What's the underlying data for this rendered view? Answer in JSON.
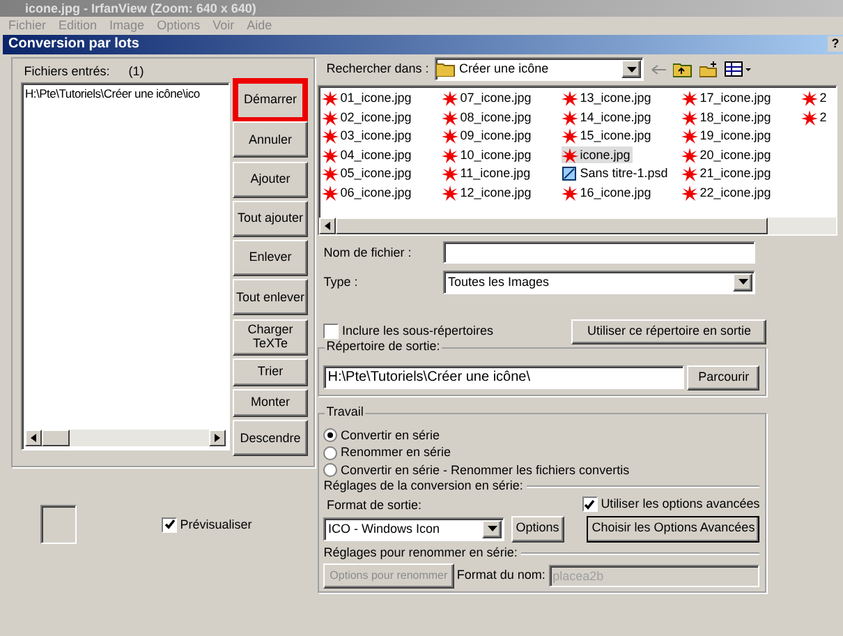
{
  "app_window": {
    "title": "icone.jpg - IrfanView (Zoom: 640 x 640)",
    "menu": [
      "Fichier",
      "Edition",
      "Image",
      "Options",
      "Voir",
      "Aide"
    ]
  },
  "dialog": {
    "title": "Conversion par lots",
    "help": "?"
  },
  "input_files": {
    "label": "Fichiers entrés:",
    "count": "(1)",
    "items": [
      "H:\\Pte\\Tutoriels\\Créer une icône\\ico"
    ]
  },
  "action_buttons": [
    {
      "label": "Démarrer",
      "highlighted": true
    },
    {
      "label": "Annuler",
      "highlighted": false
    },
    {
      "label": "Ajouter",
      "highlighted": false
    },
    {
      "label": "Tout ajouter",
      "highlighted": false
    },
    {
      "label": "Enlever",
      "highlighted": false
    },
    {
      "label": "Tout enlever",
      "highlighted": false
    },
    {
      "label": "Charger TeXTe",
      "highlighted": false
    },
    {
      "label": "Trier",
      "highlighted": false
    },
    {
      "label": "Monter",
      "highlighted": false
    },
    {
      "label": "Descendre",
      "highlighted": false
    }
  ],
  "preview": {
    "label": "Prévisualiser",
    "checked": true
  },
  "browser": {
    "look_in_label": "Rechercher dans :",
    "folder": "Créer une icône",
    "files": [
      {
        "name": "01_icone.jpg",
        "kind": "jpg",
        "selected": false
      },
      {
        "name": "02_icone.jpg",
        "kind": "jpg",
        "selected": false
      },
      {
        "name": "03_icone.jpg",
        "kind": "jpg",
        "selected": false
      },
      {
        "name": "04_icone.jpg",
        "kind": "jpg",
        "selected": false
      },
      {
        "name": "05_icone.jpg",
        "kind": "jpg",
        "selected": false
      },
      {
        "name": "06_icone.jpg",
        "kind": "jpg",
        "selected": false
      },
      {
        "name": "07_icone.jpg",
        "kind": "jpg",
        "selected": false
      },
      {
        "name": "08_icone.jpg",
        "kind": "jpg",
        "selected": false
      },
      {
        "name": "09_icone.jpg",
        "kind": "jpg",
        "selected": false
      },
      {
        "name": "10_icone.jpg",
        "kind": "jpg",
        "selected": false
      },
      {
        "name": "11_icone.jpg",
        "kind": "jpg",
        "selected": false
      },
      {
        "name": "12_icone.jpg",
        "kind": "jpg",
        "selected": false
      },
      {
        "name": "13_icone.jpg",
        "kind": "jpg",
        "selected": false
      },
      {
        "name": "14_icone.jpg",
        "kind": "jpg",
        "selected": false
      },
      {
        "name": "15_icone.jpg",
        "kind": "jpg",
        "selected": false
      },
      {
        "name": "icone.jpg",
        "kind": "jpg",
        "selected": true
      },
      {
        "name": "Sans titre-1.psd",
        "kind": "psd",
        "selected": false
      },
      {
        "name": "16_icone.jpg",
        "kind": "jpg",
        "selected": false
      },
      {
        "name": "17_icone.jpg",
        "kind": "jpg",
        "selected": false
      },
      {
        "name": "18_icone.jpg",
        "kind": "jpg",
        "selected": false
      },
      {
        "name": "19_icone.jpg",
        "kind": "jpg",
        "selected": false
      },
      {
        "name": "20_icone.jpg",
        "kind": "jpg",
        "selected": false
      },
      {
        "name": "21_icone.jpg",
        "kind": "jpg",
        "selected": false
      },
      {
        "name": "22_icone.jpg",
        "kind": "jpg",
        "selected": false
      },
      {
        "name": "2",
        "kind": "jpg",
        "selected": false
      },
      {
        "name": "2",
        "kind": "jpg",
        "selected": false
      }
    ],
    "filename_label": "Nom de fichier :",
    "type_label": "Type :",
    "type_value": "Toutes les Images"
  },
  "include_subfolders": {
    "label": "Inclure les sous-répertoires",
    "checked": false
  },
  "use_folder_button": "Utiliser ce répertoire en sortie",
  "output_dir": {
    "label": "Répertoire de sortie:",
    "value": "H:\\Pte\\Tutoriels\\Créer une icône\\",
    "browse_button": "Parcourir"
  },
  "work": {
    "label": "Travail",
    "options": [
      {
        "label": "Convertir en série",
        "selected": true
      },
      {
        "label": "Renommer en série",
        "selected": false
      },
      {
        "label": "Convertir en série - Renommer les fichiers convertis",
        "selected": false
      }
    ]
  },
  "conversion": {
    "label": "Réglages de la conversion en série:",
    "format_label": "Format de sortie:",
    "format_value": "ICO - Windows Icon",
    "options_button": "Options",
    "advanced": {
      "label": "Utiliser les options avancées",
      "checked": true
    },
    "advanced_button": "Choisir les Options Avancées"
  },
  "rename": {
    "label": "Réglages pour renommer en série:",
    "options_button": "Options pour renommer",
    "name_format_label": "Format du nom:",
    "name_format_value": "placea2b",
    "disabled": true
  }
}
